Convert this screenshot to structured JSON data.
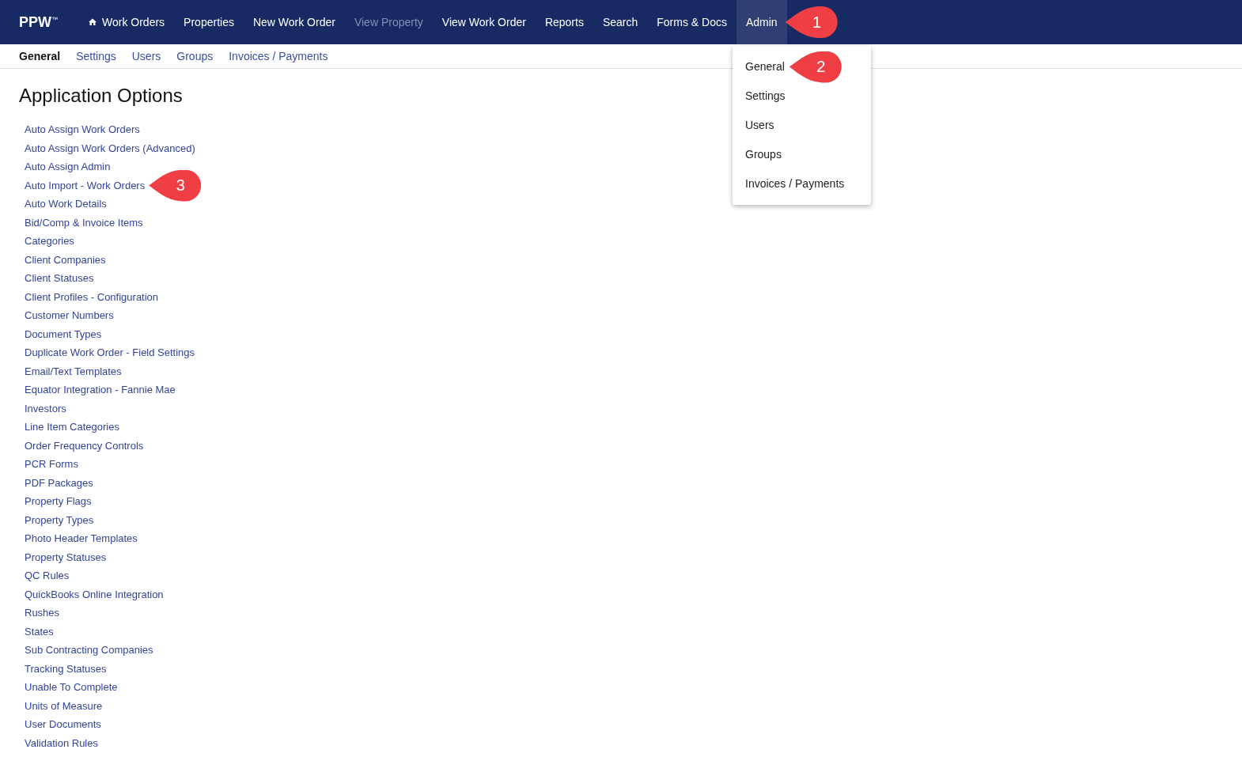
{
  "brand": "PPW$^{™}$",
  "nav": [
    {
      "label": "Work Orders",
      "selected": false,
      "disabled": false
    },
    {
      "label": "Properties",
      "selected": false,
      "disabled": false
    },
    {
      "label": "New Work Order",
      "selected": false,
      "disabled": false
    },
    {
      "label": "View Property",
      "selected": false,
      "disabled": true
    },
    {
      "label": "View Work Order",
      "selected": false,
      "disabled": false
    },
    {
      "label": "Reports",
      "selected": false,
      "disabled": false
    },
    {
      "label": "Search",
      "selected": false,
      "disabled": false
    },
    {
      "label": "Forms & Docs",
      "selected": false,
      "disabled": false
    },
    {
      "label": "Admin",
      "selected": true,
      "disabled": false,
      "callout": "1"
    }
  ],
  "subnav": [
    {
      "label": "General",
      "selected": true
    },
    {
      "label": "Settings",
      "selected": false
    },
    {
      "label": "Users",
      "selected": false
    },
    {
      "label": "Groups",
      "selected": false
    },
    {
      "label": "Invoices / Payments",
      "selected": false
    }
  ],
  "dropdown": [
    {
      "label": "General",
      "callout": "2"
    },
    {
      "label": "Settings"
    },
    {
      "label": "Users"
    },
    {
      "label": "Groups"
    },
    {
      "label": "Invoices / Payments"
    }
  ],
  "heading": "Application Options",
  "links": [
    {
      "label": "Auto Assign Work Orders"
    },
    {
      "label": "Auto Assign Work Orders (Advanced)"
    },
    {
      "label": "Auto Assign Admin"
    },
    {
      "label": "Auto Import - Work Orders",
      "callout": "3"
    },
    {
      "label": "Auto Work Details"
    },
    {
      "label": "Bid/Comp & Invoice Items"
    },
    {
      "label": "Categories"
    },
    {
      "label": "Client Companies"
    },
    {
      "label": "Client Statuses"
    },
    {
      "label": "Client Profiles - Configuration"
    },
    {
      "label": "Customer Numbers"
    },
    {
      "label": "Document Types"
    },
    {
      "label": "Duplicate Work Order - Field Settings"
    },
    {
      "label": "Email/Text Templates"
    },
    {
      "label": "Equator Integration - Fannie Mae"
    },
    {
      "label": "Investors"
    },
    {
      "label": "Line Item Categories"
    },
    {
      "label": "Order Frequency Controls"
    },
    {
      "label": "PCR Forms"
    },
    {
      "label": "PDF Packages"
    },
    {
      "label": "Property Flags"
    },
    {
      "label": "Property Types"
    },
    {
      "label": "Photo Header Templates"
    },
    {
      "label": "Property Statuses"
    },
    {
      "label": "QC Rules"
    },
    {
      "label": "QuickBooks Online Integration"
    },
    {
      "label": "Rushes"
    },
    {
      "label": "States"
    },
    {
      "label": "Sub Contracting Companies"
    },
    {
      "label": "Tracking Statuses"
    },
    {
      "label": "Unable To Complete"
    },
    {
      "label": "Units of Measure"
    },
    {
      "label": "User Documents"
    },
    {
      "label": "Validation Rules"
    }
  ]
}
